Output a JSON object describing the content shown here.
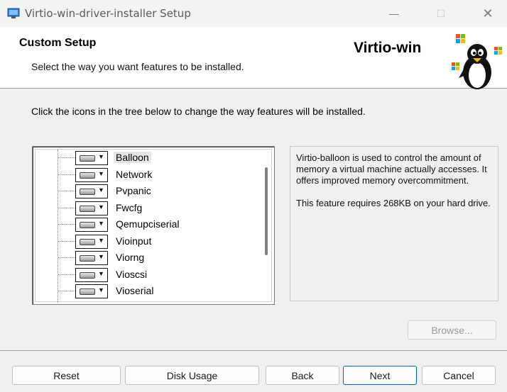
{
  "window": {
    "title": "Virtio-win-driver-installer Setup",
    "minimize_glyph": "—",
    "maximize_glyph": "☐",
    "close_glyph": "✕"
  },
  "header": {
    "title": "Custom Setup",
    "subtitle": "Select the way you want features to be installed.",
    "brand": "Virtio-win"
  },
  "instructions": "Click the icons in the tree below to change the way features will be installed.",
  "features": [
    {
      "label": "Balloon",
      "selected": true
    },
    {
      "label": "Network",
      "selected": false
    },
    {
      "label": "Pvpanic",
      "selected": false
    },
    {
      "label": "Fwcfg",
      "selected": false
    },
    {
      "label": "Qemupciserial",
      "selected": false
    },
    {
      "label": "Vioinput",
      "selected": false
    },
    {
      "label": "Viorng",
      "selected": false
    },
    {
      "label": "Vioscsi",
      "selected": false
    },
    {
      "label": "Vioserial",
      "selected": false
    }
  ],
  "description": {
    "text": "Virtio-balloon is used to control the amount of memory a virtual machine actually accesses. It offers improved memory overcommitment.",
    "requirement": "This feature requires 268KB on your hard drive."
  },
  "buttons": {
    "browse": "Browse...",
    "reset": "Reset",
    "disk_usage": "Disk Usage",
    "back": "Back",
    "next": "Next",
    "cancel": "Cancel"
  },
  "icons": {
    "app": "installer-app-icon",
    "drive": "hard-drive-icon",
    "dropdown": "dropdown-arrow-icon",
    "mascot": "tux-windows-logo"
  },
  "colors": {
    "accent": "#0067c0",
    "win_red": "#f35325",
    "win_green": "#81bc06",
    "win_blue": "#05a6f0",
    "win_yellow": "#ffba08"
  }
}
